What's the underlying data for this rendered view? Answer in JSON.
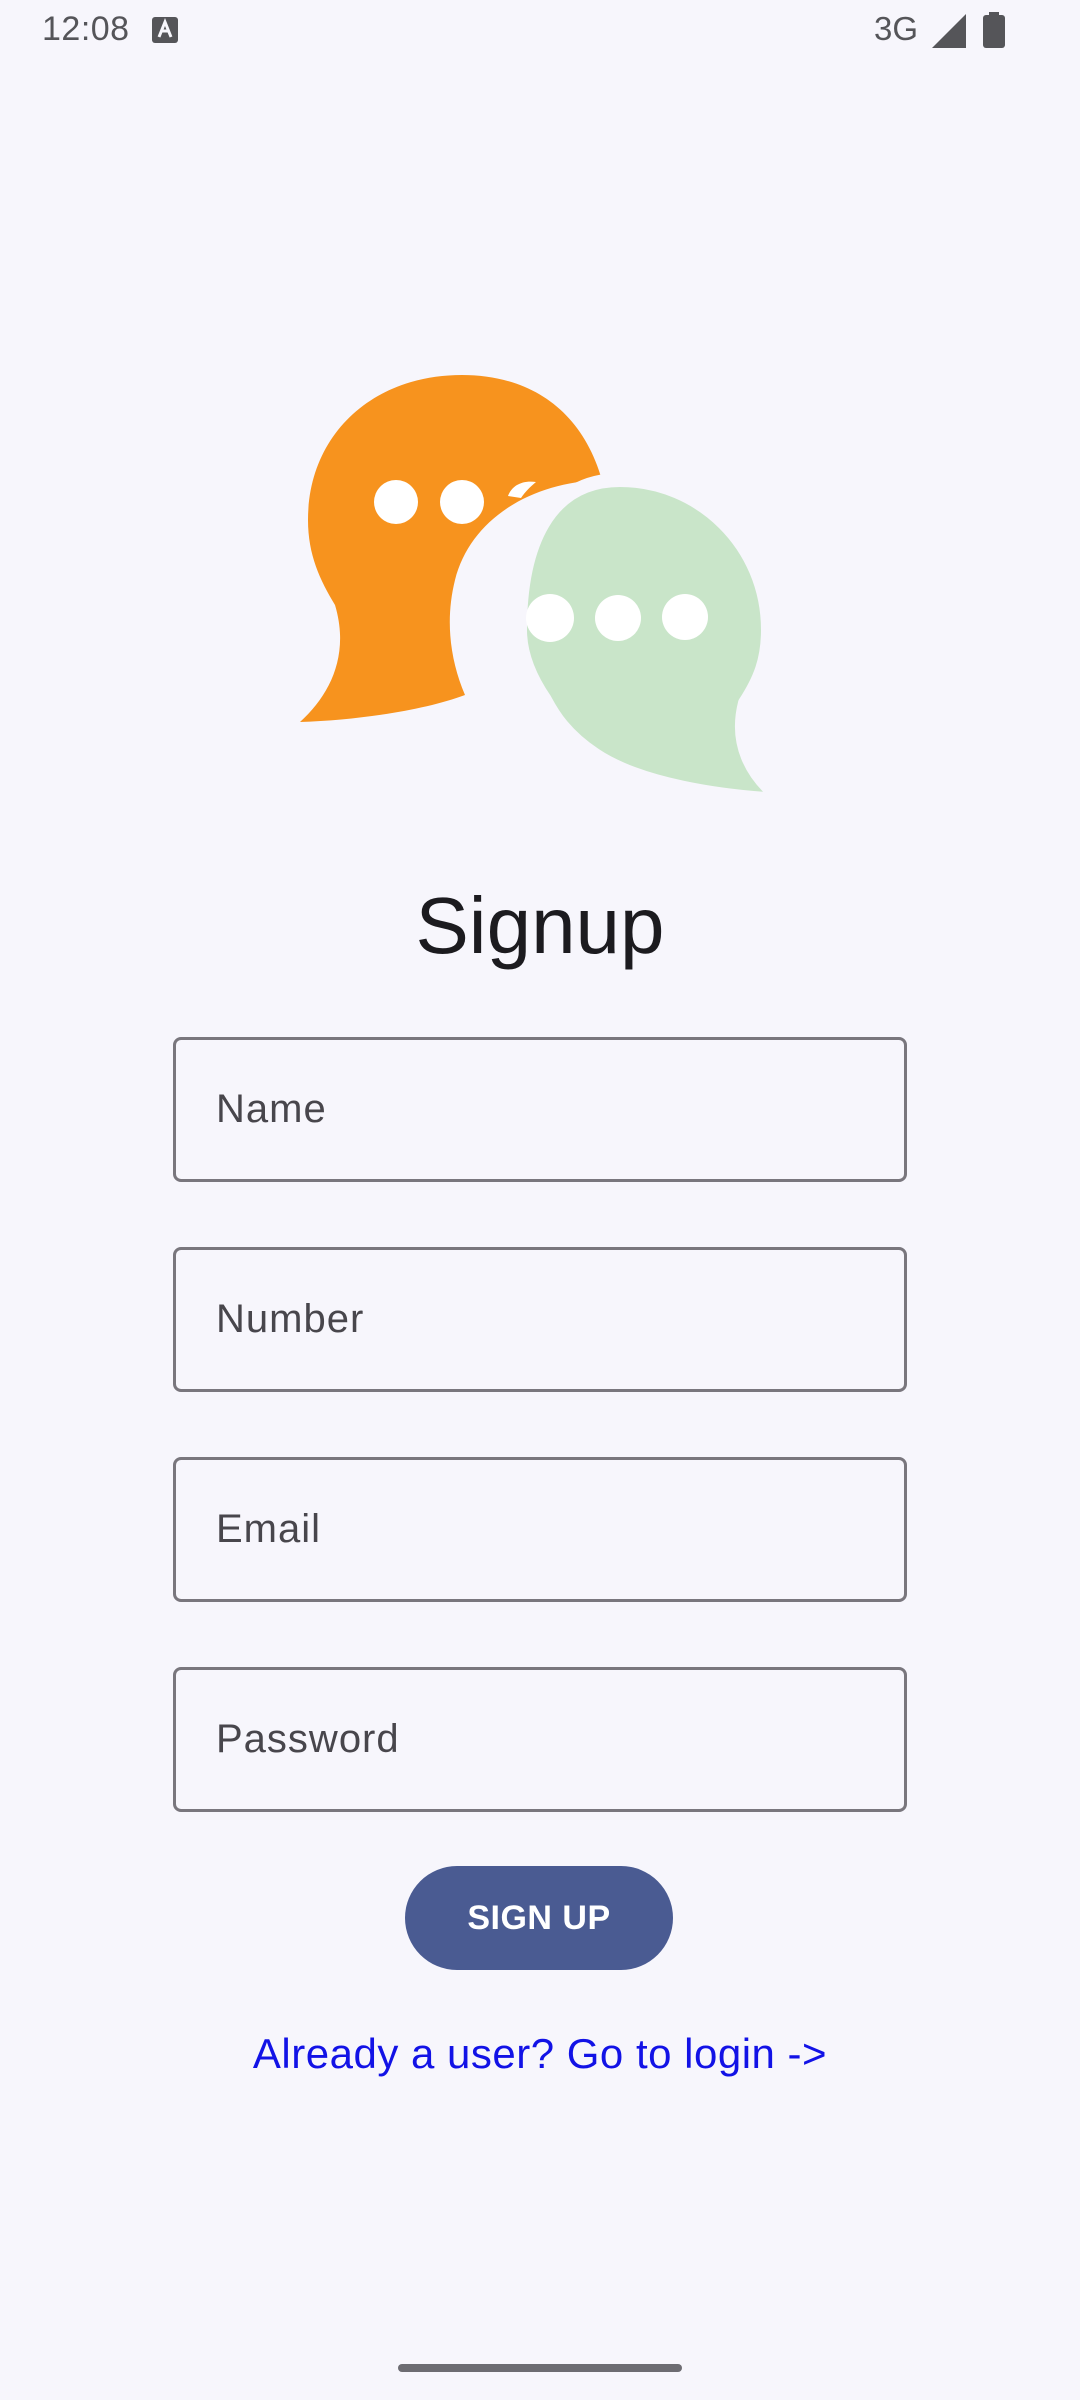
{
  "status_bar": {
    "time": "12:08",
    "network": "3G",
    "icons": [
      "a-icon",
      "signal-icon",
      "battery-icon"
    ]
  },
  "logo": {
    "icon": "chat-bubbles-icon",
    "colors": {
      "bubble_back": "#f7931e",
      "bubble_front": "#c9e5c9",
      "dots": "#ffffff"
    }
  },
  "title": "Signup",
  "form": {
    "name_placeholder": "Name",
    "number_placeholder": "Number",
    "email_placeholder": "Email",
    "password_placeholder": "Password",
    "submit_label": "SIGN UP"
  },
  "login_link": "Already a user? Go to login ->",
  "colors": {
    "background": "#f7f6fc",
    "button": "#4a5b92",
    "link": "#1212e6",
    "field_border": "#79767d"
  }
}
